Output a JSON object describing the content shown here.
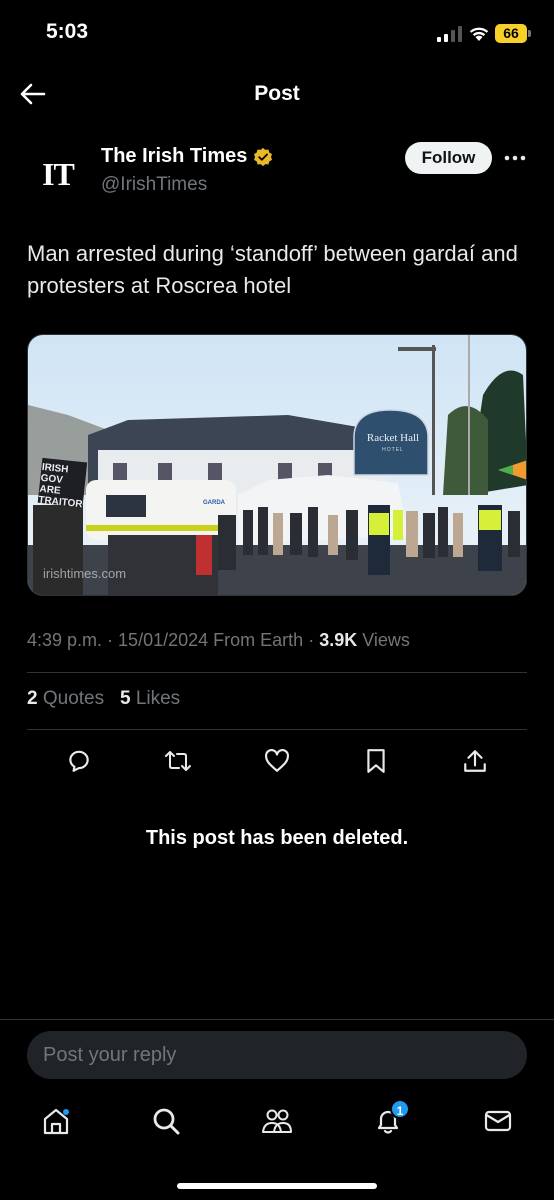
{
  "status_bar": {
    "time": "5:03",
    "battery": "66",
    "battery_color": "#f7d12a"
  },
  "header": {
    "title": "Post",
    "back_icon": "arrow-left-icon"
  },
  "author": {
    "avatar_text": "IT",
    "name": "The Irish Times",
    "handle": "@IrishTimes",
    "verified_color": "#e8b829",
    "follow_label": "Follow"
  },
  "post": {
    "text": "Man arrested during ‘standoff’ between gardaí and protesters at Roscrea hotel",
    "image": {
      "sign_title": "Racket Hall",
      "sign_sub": "HOTEL",
      "watermark": "irishtimes.com",
      "protest_sign": "IRISH GOV ARE TRAITOR",
      "van_label": "GARDA"
    }
  },
  "meta": {
    "time": "4:39 p.m.",
    "date": "15/01/2024",
    "source": "From Earth",
    "views_count": "3.9K",
    "views_label": "Views"
  },
  "stats": {
    "quotes_count": "2",
    "quotes_label": "Quotes",
    "likes_count": "5",
    "likes_label": "Likes"
  },
  "actions": [
    "reply-icon",
    "repost-icon",
    "like-icon",
    "bookmark-icon",
    "share-icon"
  ],
  "deleted_notice": "This post has been deleted.",
  "reply": {
    "placeholder": "Post your reply"
  },
  "tabbar": {
    "items": [
      "home-icon",
      "search-icon",
      "communities-icon",
      "notifications-icon",
      "messages-icon"
    ],
    "notification_badge": "1"
  },
  "colors": {
    "background": "#000000",
    "accent": "#1d9bf0",
    "muted": "#71767b",
    "divider": "#2f3336"
  }
}
